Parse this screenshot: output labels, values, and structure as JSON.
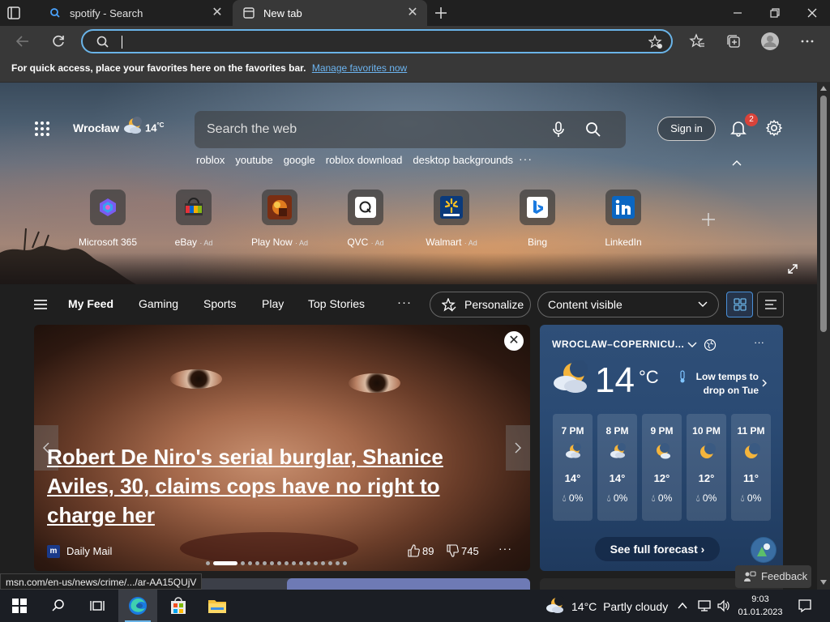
{
  "browser": {
    "tabs": [
      {
        "title": "spotify - Search",
        "active": false
      },
      {
        "title": "New tab",
        "active": true
      }
    ],
    "address_value": "",
    "favorites_bar": {
      "message": "For quick access, place your favorites here on the favorites bar.",
      "link": "Manage favorites now"
    }
  },
  "header": {
    "location": "Wrocław",
    "temp": "14",
    "temp_unit": "°C",
    "search_placeholder": "Search the web",
    "signin": "Sign in",
    "notifications": "2",
    "trending": [
      "roblox",
      "youtube",
      "google",
      "roblox download",
      "desktop backgrounds"
    ],
    "more": "···"
  },
  "quick_links": [
    {
      "label": "Microsoft 365",
      "ad": "",
      "icon": "microsoft-365-icon"
    },
    {
      "label": "eBay",
      "ad": "· Ad",
      "icon": "ebay-icon"
    },
    {
      "label": "Play Now",
      "ad": "· Ad",
      "icon": "play-now-icon"
    },
    {
      "label": "QVC",
      "ad": "· Ad",
      "icon": "qvc-icon"
    },
    {
      "label": "Walmart",
      "ad": "· Ad",
      "icon": "walmart-icon"
    },
    {
      "label": "Bing",
      "ad": "",
      "icon": "bing-icon"
    },
    {
      "label": "LinkedIn",
      "ad": "",
      "icon": "linkedin-icon"
    }
  ],
  "nav": {
    "items": [
      "My Feed",
      "Gaming",
      "Sports",
      "Play",
      "Top Stories"
    ],
    "more": "···",
    "personalize": "Personalize",
    "content_select": "Content visible"
  },
  "news": {
    "headline": "Robert De Niro's serial burglar, Shanice Aviles, 30, claims cops have no right to charge her",
    "source_logo": "m",
    "source": "Daily Mail",
    "likes": "89",
    "dislikes": "745",
    "more": "···",
    "slide_count": 17,
    "active_slide": 1
  },
  "weather": {
    "location": "WROCLAW–COPERNICU...",
    "more": "···",
    "temp": "14",
    "unit": "°C",
    "alert": "Low temps to drop on Tue",
    "hourly": [
      {
        "time": "7 PM",
        "temp": "14°",
        "precip": "0%",
        "icon": "cloudy-night-icon"
      },
      {
        "time": "8 PM",
        "temp": "14°",
        "precip": "0%",
        "icon": "cloudy-night-icon"
      },
      {
        "time": "9 PM",
        "temp": "12°",
        "precip": "0%",
        "icon": "partly-cloudy-night-icon"
      },
      {
        "time": "10 PM",
        "temp": "12°",
        "precip": "0%",
        "icon": "clear-night-icon"
      },
      {
        "time": "11 PM",
        "temp": "11°",
        "precip": "0%",
        "icon": "clear-night-icon"
      }
    ],
    "forecast_btn": "See full forecast"
  },
  "feedback": "Feedback",
  "status_url": "msn.com/en-us/news/crime/.../ar-AA15QUjV",
  "taskbar": {
    "weather_temp": "14°C",
    "weather_desc": "Partly cloudy",
    "time": "9:03",
    "date": "01.01.2023"
  },
  "colors": {
    "accent": "#6ab4e8",
    "weather_card": "#2a4a73",
    "badge": "#d9433a"
  }
}
